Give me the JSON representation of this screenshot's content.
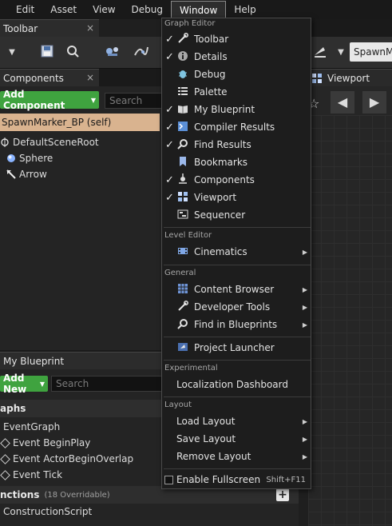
{
  "menubar": {
    "items": [
      "Edit",
      "Asset",
      "View",
      "Debug",
      "Window",
      "Help"
    ],
    "active": "Window"
  },
  "panels": {
    "toolbar_tab": "Toolbar",
    "components_tab": "Components",
    "my_blueprint_tab": "My Blueprint",
    "viewport_tab": "Viewport",
    "close_glyph": "×"
  },
  "toolbar": {
    "spawn_dropdown": "SpawnM"
  },
  "components": {
    "add_button": "Add Component",
    "search_placeholder": "Search",
    "self_row": "SpawnMarker_BP (self)",
    "tree": [
      "DefaultSceneRoot",
      "Sphere",
      "Arrow"
    ]
  },
  "my_blueprint": {
    "add_new": "Add New",
    "search_placeholder": "Search",
    "graphs_header": "aphs",
    "event_graph": "EventGraph",
    "events": [
      "Event BeginPlay",
      "Event ActorBeginOverlap",
      "Event Tick"
    ],
    "functions_header": "nctions",
    "functions_overridable": "(18 Overridable)",
    "construction_script": "ConstructionScript"
  },
  "window_menu": {
    "sections": {
      "graph_editor": "Graph Editor",
      "level_editor": "Level Editor",
      "general": "General",
      "experimental": "Experimental",
      "layout": "Layout"
    },
    "graph_editor_items": [
      {
        "label": "Toolbar",
        "checked": true,
        "icon": "wrench-icon"
      },
      {
        "label": "Details",
        "checked": true,
        "icon": "info-icon"
      },
      {
        "label": "Debug",
        "checked": false,
        "icon": "bug-icon"
      },
      {
        "label": "Palette",
        "checked": false,
        "icon": "list-icon"
      },
      {
        "label": "My Blueprint",
        "checked": true,
        "icon": "book-icon"
      },
      {
        "label": "Compiler Results",
        "checked": true,
        "icon": "console-icon"
      },
      {
        "label": "Find Results",
        "checked": true,
        "icon": "magnifier-icon"
      },
      {
        "label": "Bookmarks",
        "checked": false,
        "icon": "bookmark-icon"
      },
      {
        "label": "Components",
        "checked": true,
        "icon": "components-icon"
      },
      {
        "label": "Viewport",
        "checked": true,
        "icon": "viewport-icon"
      },
      {
        "label": "Sequencer",
        "checked": false,
        "icon": "sequencer-icon"
      }
    ],
    "level_editor_items": [
      {
        "label": "Cinematics",
        "icon": "film-icon",
        "submenu": true
      }
    ],
    "general_items": [
      {
        "label": "Content Browser",
        "icon": "grid-icon",
        "submenu": true
      },
      {
        "label": "Developer Tools",
        "icon": "wrench-icon",
        "submenu": true
      },
      {
        "label": "Find in Blueprints",
        "icon": "magnifier-icon",
        "submenu": true
      },
      {
        "label": "Project Launcher",
        "icon": "launcher-icon",
        "submenu": false
      }
    ],
    "experimental_items": [
      {
        "label": "Localization Dashboard"
      }
    ],
    "layout_items": [
      {
        "label": "Load Layout",
        "submenu": true
      },
      {
        "label": "Save Layout",
        "submenu": true
      },
      {
        "label": "Remove Layout",
        "submenu": true
      }
    ],
    "fullscreen": {
      "label": "Enable Fullscreen",
      "shortcut": "Shift+F11",
      "checked": false
    }
  },
  "colors": {
    "accent_green": "#3fa33f",
    "self_row": "#d9b38f",
    "menu_bg": "#1d1d1d"
  }
}
